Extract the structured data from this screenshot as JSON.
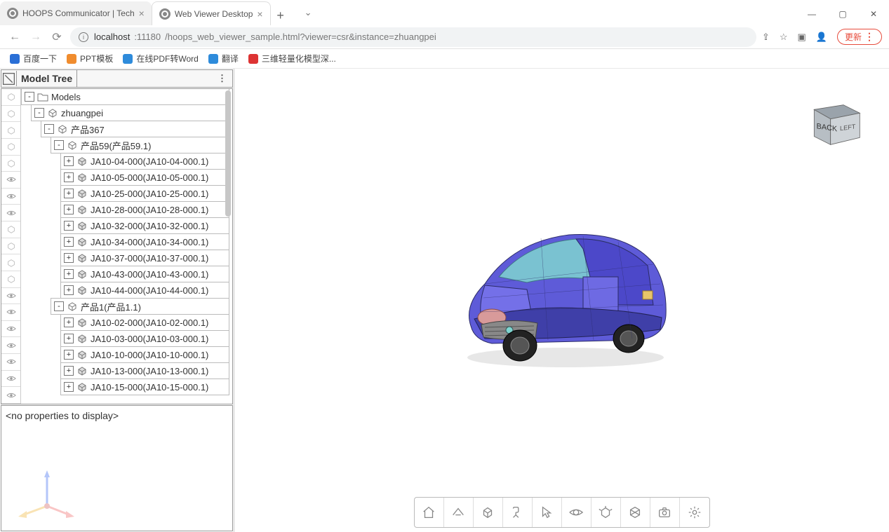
{
  "browser": {
    "tabs": [
      {
        "title": "HOOPS Communicator | Tech",
        "active": false
      },
      {
        "title": "Web Viewer Desktop",
        "active": true
      }
    ],
    "url_host": "localhost",
    "url_port": ":11180",
    "url_path": "/hoops_web_viewer_sample.html?viewer=csr&instance=zhuangpei",
    "update_label": "更新",
    "bookmarks": [
      {
        "label": "百度一下",
        "color": "#2a6fd6"
      },
      {
        "label": "PPT模板",
        "color": "#f08c2e"
      },
      {
        "label": "在线PDF转Word",
        "color": "#2e8bdb"
      },
      {
        "label": "翻译",
        "color": "#2e8bdb"
      },
      {
        "label": "三维轻量化模型深...",
        "color": "#d33"
      }
    ]
  },
  "panel": {
    "title": "Model Tree",
    "properties_empty": "<no properties to display>"
  },
  "navcube": {
    "face1": "BACK",
    "face2": "LEFT"
  },
  "tree": [
    {
      "depth": 0,
      "toggle": "-",
      "icon": "folder",
      "label": "Models",
      "eye": "iso"
    },
    {
      "depth": 1,
      "toggle": "-",
      "icon": "asm",
      "label": "zhuangpei",
      "eye": "iso"
    },
    {
      "depth": 2,
      "toggle": "-",
      "icon": "asm",
      "label": "产品367",
      "eye": "iso"
    },
    {
      "depth": 3,
      "toggle": "-",
      "icon": "asm",
      "label": "产品59(产品59.1)",
      "eye": "iso"
    },
    {
      "depth": 4,
      "toggle": "+",
      "icon": "part",
      "label": "JA10-04-000(JA10-04-000.1)",
      "eye": "iso"
    },
    {
      "depth": 4,
      "toggle": "+",
      "icon": "part",
      "label": "JA10-05-000(JA10-05-000.1)",
      "eye": "eye"
    },
    {
      "depth": 4,
      "toggle": "+",
      "icon": "part",
      "label": "JA10-25-000(JA10-25-000.1)",
      "eye": "eye"
    },
    {
      "depth": 4,
      "toggle": "+",
      "icon": "part",
      "label": "JA10-28-000(JA10-28-000.1)",
      "eye": "eye"
    },
    {
      "depth": 4,
      "toggle": "+",
      "icon": "part",
      "label": "JA10-32-000(JA10-32-000.1)",
      "eye": "iso"
    },
    {
      "depth": 4,
      "toggle": "+",
      "icon": "part",
      "label": "JA10-34-000(JA10-34-000.1)",
      "eye": "iso"
    },
    {
      "depth": 4,
      "toggle": "+",
      "icon": "part",
      "label": "JA10-37-000(JA10-37-000.1)",
      "eye": "iso"
    },
    {
      "depth": 4,
      "toggle": "+",
      "icon": "part",
      "label": "JA10-43-000(JA10-43-000.1)",
      "eye": "iso"
    },
    {
      "depth": 4,
      "toggle": "+",
      "icon": "part",
      "label": "JA10-44-000(JA10-44-000.1)",
      "eye": "eye"
    },
    {
      "depth": 3,
      "toggle": "-",
      "icon": "asm",
      "label": "产品1(产品1.1)",
      "eye": "eye"
    },
    {
      "depth": 4,
      "toggle": "+",
      "icon": "part",
      "label": "JA10-02-000(JA10-02-000.1)",
      "eye": "eye"
    },
    {
      "depth": 4,
      "toggle": "+",
      "icon": "part",
      "label": "JA10-03-000(JA10-03-000.1)",
      "eye": "eye"
    },
    {
      "depth": 4,
      "toggle": "+",
      "icon": "part",
      "label": "JA10-10-000(JA10-10-000.1)",
      "eye": "eye"
    },
    {
      "depth": 4,
      "toggle": "+",
      "icon": "part",
      "label": "JA10-13-000(JA10-13-000.1)",
      "eye": "eye"
    },
    {
      "depth": 4,
      "toggle": "+",
      "icon": "part",
      "label": "JA10-15-000(JA10-15-000.1)",
      "eye": "eye"
    }
  ],
  "toolbar": [
    "home",
    "camera-mode",
    "cube",
    "text",
    "select",
    "orbit",
    "explode",
    "cutplane",
    "snapshot",
    "settings"
  ]
}
